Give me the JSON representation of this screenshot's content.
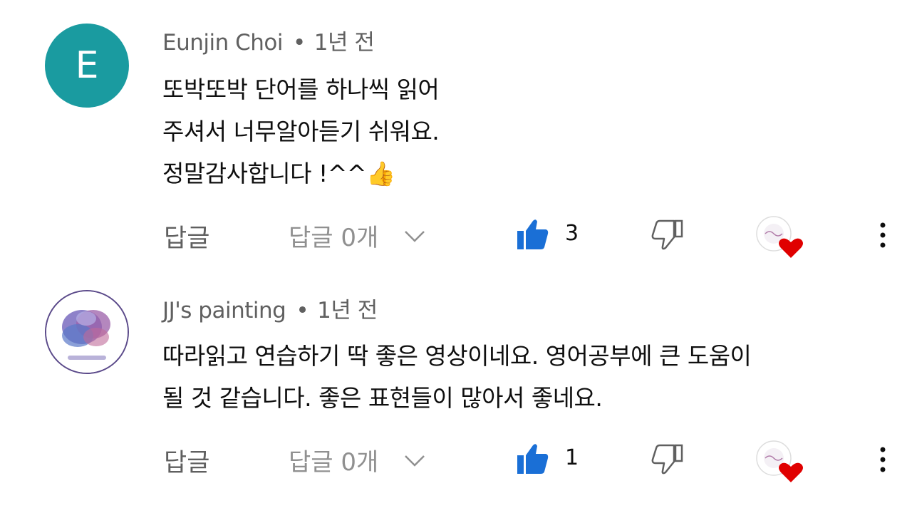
{
  "comments": [
    {
      "avatar_letter": "E",
      "author": "Eunjin Choi",
      "separator": "•",
      "time": "1년 전",
      "text_lines": [
        "또박또박 단어를 하나씩 읽어",
        "주셔서 너무알아듣기 쉬워요.",
        "정말감사합니다 !^^👍"
      ],
      "reply_label": "답글",
      "replies_label": "답글 0개",
      "like_count": "3",
      "creator_heart": true,
      "liked": true
    },
    {
      "avatar_letter": "",
      "author": "JJ's painting",
      "separator": "•",
      "time": "1년 전",
      "text_lines": [
        "따라읽고 연습하기 딱 좋은 영상이네요. 영어공부에 큰 도움이",
        "될 것 같습니다. 좋은 표현들이 많아서 좋네요."
      ],
      "reply_label": "답글",
      "replies_label": "답글 0개",
      "like_count": "1",
      "creator_heart": true,
      "liked": true
    }
  ],
  "icons": {
    "like": "thumb-up-icon",
    "dislike": "thumb-down-icon",
    "expand": "chevron-down-icon",
    "heart": "creator-heart-icon",
    "more": "more-vert-icon"
  },
  "colors": {
    "like_blue": "#1a6fd6",
    "heart_red": "#e00000",
    "avatar_teal": "#1a9ba0",
    "muted_text": "#606060"
  }
}
